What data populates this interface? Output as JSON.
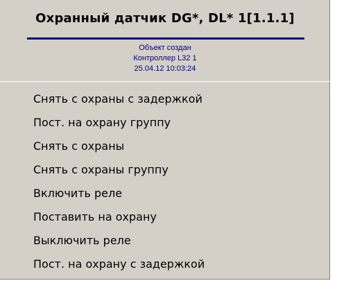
{
  "header": {
    "title": "Охранный датчик DG*, DL* 1[1.1.1]",
    "info": [
      "Объект создан",
      "Контроллер L32 1",
      "25.04.12 10:03:24"
    ]
  },
  "menu": {
    "items": [
      {
        "label": "Снять с охраны с задержкой"
      },
      {
        "label": "Пост. на охрану группу"
      },
      {
        "label": "Снять с охраны"
      },
      {
        "label": "Снять с охраны группу"
      },
      {
        "label": "Включить реле"
      },
      {
        "label": "Поставить на охрану"
      },
      {
        "label": "Выключить реле"
      },
      {
        "label": "Пост. на охрану с задержкой"
      }
    ]
  },
  "colors": {
    "menu_background": "#d4d0c8",
    "title_underline": "#000080",
    "info_text": "#000080"
  }
}
